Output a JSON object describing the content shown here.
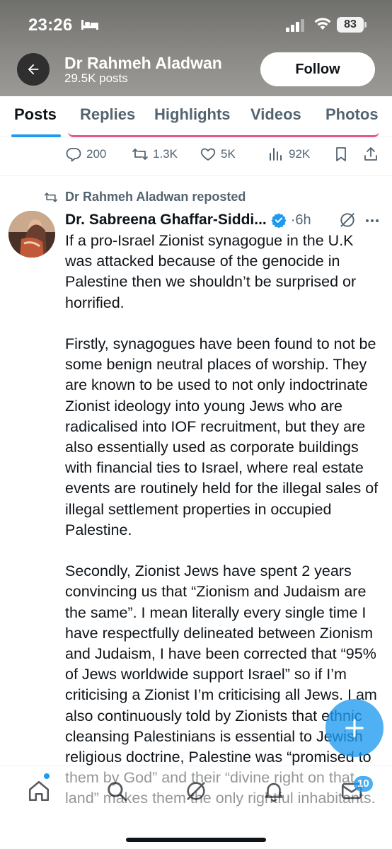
{
  "status_bar": {
    "time": "23:26",
    "battery": "83"
  },
  "profile_header": {
    "name": "Dr Rahmeh Aladwan",
    "posts": "29.5K posts",
    "follow_label": "Follow"
  },
  "tabs": [
    {
      "label": "Posts",
      "active": true
    },
    {
      "label": "Replies",
      "active": false
    },
    {
      "label": "Highlights",
      "active": false
    },
    {
      "label": "Videos",
      "active": false
    },
    {
      "label": "Photos",
      "active": false
    }
  ],
  "previous_post_actions": {
    "replies": "200",
    "reposts": "1.3K",
    "likes": "5K",
    "views": "92K"
  },
  "post": {
    "repost_label": "Dr Rahmeh Aladwan reposted",
    "author": "Dr. Sabreena Ghaffar-Siddi...",
    "time": "·6h",
    "text": "If a pro-Israel Zionist synagogue in the U.K was attacked because of the genocide in Palestine then we shouldn’t be surprised or horrified.\n\nFirstly, synagogues have been found to not be some benign neutral places of worship. They are known to be used to not only indoctrinate Zionist ideology into young Jews who are radicalised into IOF recruitment, but they are also essentially used as corporate buildings with financial ties to Israel, where real estate events are routinely held for the illegal sales of illegal settlement properties in occupied Palestine.\n\nSecondly, Zionist Jews have spent 2 years convincing us that “Zionism and Judaism are the same”. I mean literally every single time I have respectfully delineated between Zionism and Judaism, I have been corrected that “95% of Jews worldwide support Israel” so if I’m criticising a Zionist I’m criticising all Jews. I am also continuously told by Zionists that ethnic cleansing Palestinians is essential to Jewish religious doctrine, Palestine was “promised to them by God” and their “divine right on that land” makes them the only rightful inhabitants."
  },
  "bottom_nav": {
    "notification_count": "10"
  },
  "colors": {
    "accent": "#1d9bf0",
    "text": "#0f1419",
    "muted": "#536471"
  }
}
